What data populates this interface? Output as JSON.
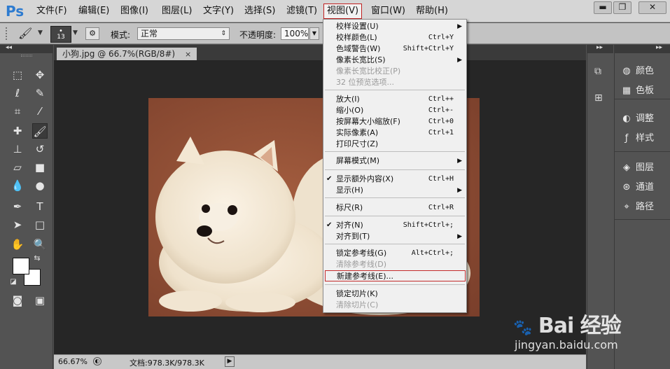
{
  "app": {
    "logo": "Ps"
  },
  "menubar": {
    "items": [
      "文件(F)",
      "编辑(E)",
      "图像(I)",
      "图层(L)",
      "文字(Y)",
      "选择(S)",
      "滤镜(T)",
      "视图(V)",
      "窗口(W)",
      "帮助(H)"
    ],
    "active": "视图(V)"
  },
  "window_buttons": {
    "minimize": "▬",
    "restore": "❐",
    "close": "✕"
  },
  "options": {
    "brush_size": "13",
    "mode_label": "模式:",
    "mode_value": "正常",
    "opacity_label": "不透明度:",
    "opacity_value": "100%"
  },
  "document": {
    "tab_title": "小狗.jpg @ 66.7%(RGB/8#)",
    "close": "×"
  },
  "status": {
    "zoom": "66.67%",
    "doc_info": "文档:978.3K/978.3K"
  },
  "panels": {
    "group1": [
      "颜色",
      "色板"
    ],
    "group2": [
      "调整",
      "样式"
    ],
    "group3": [
      "图层",
      "通道",
      "路径"
    ]
  },
  "view_menu": [
    {
      "label": "校样设置(U)",
      "shortcut": "",
      "submenu": true
    },
    {
      "label": "校样颜色(L)",
      "shortcut": "Ctrl+Y"
    },
    {
      "label": "色域警告(W)",
      "shortcut": "Shift+Ctrl+Y"
    },
    {
      "label": "像素长宽比(S)",
      "shortcut": "",
      "submenu": true
    },
    {
      "label": "像素长宽比校正(P)",
      "shortcut": "",
      "disabled": true
    },
    {
      "label": "32 位预览选项...",
      "shortcut": "",
      "disabled": true
    },
    {
      "label": "放大(I)",
      "shortcut": "Ctrl++"
    },
    {
      "label": "缩小(O)",
      "shortcut": "Ctrl+-"
    },
    {
      "label": "按屏幕大小缩放(F)",
      "shortcut": "Ctrl+0"
    },
    {
      "label": "实际像素(A)",
      "shortcut": "Ctrl+1"
    },
    {
      "label": "打印尺寸(Z)",
      "shortcut": ""
    },
    {
      "label": "屏幕模式(M)",
      "shortcut": "",
      "submenu": true
    },
    {
      "label": "显示额外内容(X)",
      "shortcut": "Ctrl+H",
      "checked": true
    },
    {
      "label": "显示(H)",
      "shortcut": "",
      "submenu": true
    },
    {
      "label": "标尺(R)",
      "shortcut": "Ctrl+R"
    },
    {
      "label": "对齐(N)",
      "shortcut": "Shift+Ctrl+;",
      "checked": true
    },
    {
      "label": "对齐到(T)",
      "shortcut": "",
      "submenu": true
    },
    {
      "label": "锁定参考线(G)",
      "shortcut": "Alt+Ctrl+;"
    },
    {
      "label": "清除参考线(D)",
      "shortcut": "",
      "disabled": true
    },
    {
      "label": "新建参考线(E)...",
      "shortcut": "",
      "highlighted": true
    },
    {
      "label": "锁定切片(K)",
      "shortcut": ""
    },
    {
      "label": "清除切片(C)",
      "shortcut": "",
      "disabled": true
    }
  ],
  "watermark": {
    "brand": "Bai 经验",
    "url": "jingyan.baidu.com"
  },
  "colors": {
    "accent": "#c42b2b",
    "photo_bg": "#8f4e35",
    "canvas_bg": "#262626"
  }
}
